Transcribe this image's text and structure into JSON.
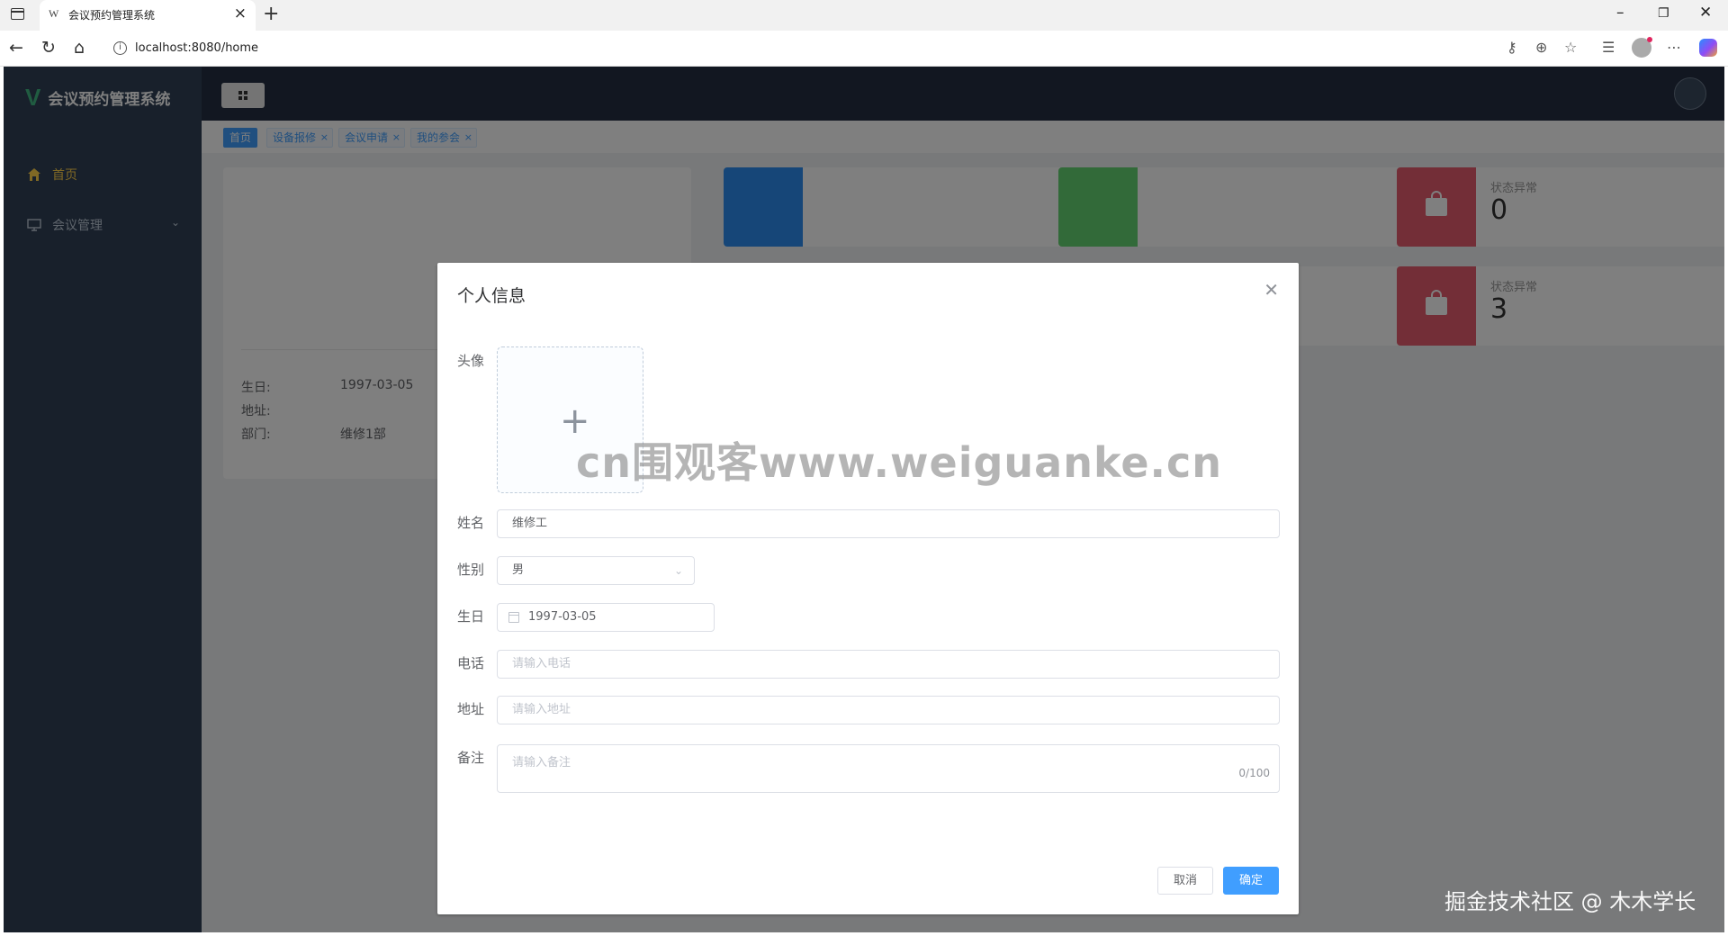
{
  "browser": {
    "tab_title": "会议预约管理系统",
    "tab_favicon": "W",
    "url": "localhost:8080/home"
  },
  "app": {
    "logo_text": "会议预约管理系统",
    "menu": [
      {
        "label": "首页",
        "icon": "home-icon",
        "active": true
      },
      {
        "label": "会议管理",
        "icon": "monitor-icon",
        "expandable": true
      }
    ],
    "tags": [
      {
        "label": "首页",
        "active": true
      },
      {
        "label": "设备报修"
      },
      {
        "label": "会议申请"
      },
      {
        "label": "我的参会"
      }
    ],
    "user_card": {
      "birthday_label": "生日:",
      "birthday_value": "1997-03-05",
      "address_label": "地址:",
      "address_value": "",
      "dept_label": "部门:",
      "dept_value": "维修1部"
    },
    "stats": [
      {
        "title": "状态异常",
        "value": "0",
        "color": "#e65d6e"
      },
      {
        "title": "状态异常",
        "value": "3",
        "color": "#e65d6e"
      }
    ],
    "stat_colors": {
      "blue": "#2d8cf0",
      "green": "#64d572",
      "red": "#f25e43"
    }
  },
  "dialog": {
    "title": "个人信息",
    "avatar_label": "头像",
    "name_label": "姓名",
    "name_value": "维修工",
    "gender_label": "性别",
    "gender_value": "男",
    "birthday_label": "生日",
    "birthday_value": "1997-03-05",
    "phone_label": "电话",
    "phone_placeholder": "请输入电话",
    "address_label": "地址",
    "address_placeholder": "请输入地址",
    "remark_label": "备注",
    "remark_placeholder": "请输入备注",
    "remark_counter": "0/100",
    "cancel_label": "取消",
    "confirm_label": "确定"
  },
  "watermarks": {
    "center": "cn围观客www.weiguanke.cn",
    "corner": "掘金技术社区 @ 木木学长"
  }
}
